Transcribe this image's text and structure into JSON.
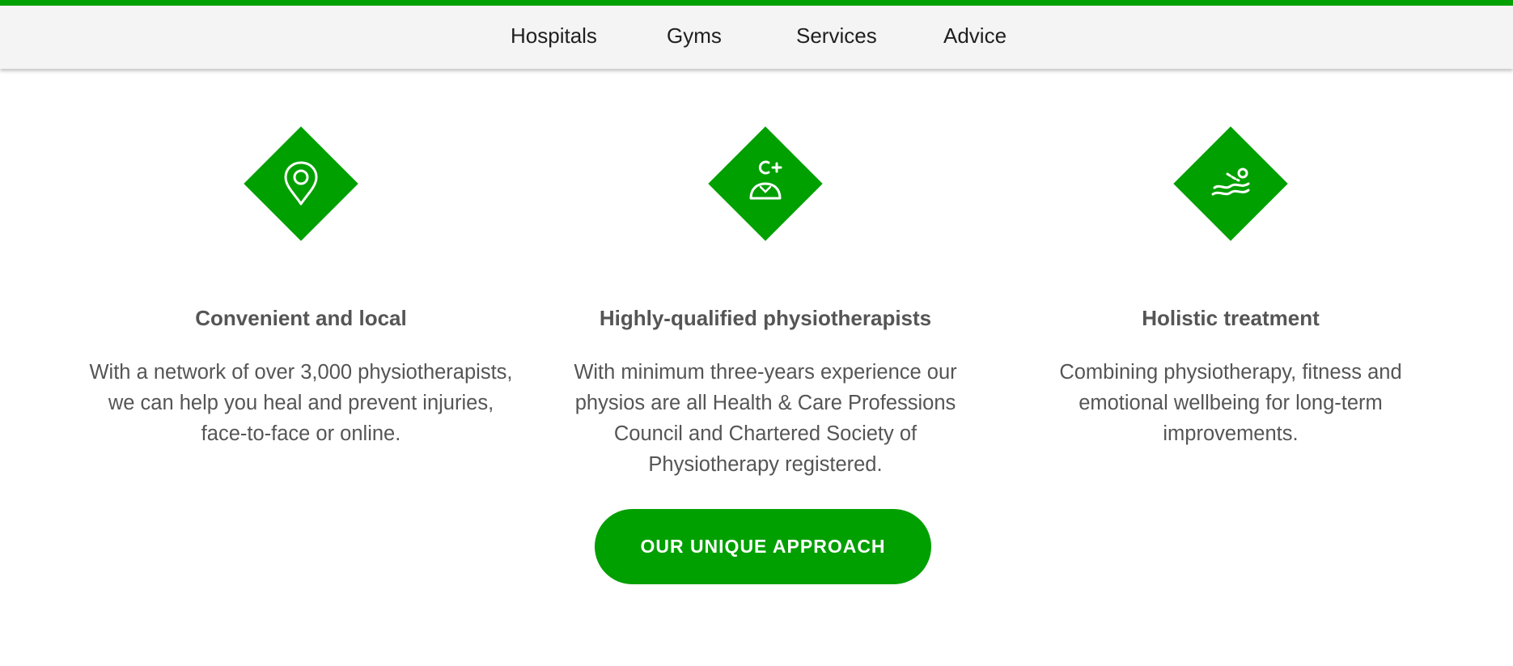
{
  "nav": {
    "items": [
      {
        "label": "Hospitals"
      },
      {
        "label": "Gyms"
      },
      {
        "label": "Services"
      },
      {
        "label": "Advice"
      }
    ]
  },
  "features": [
    {
      "icon": "location-pin-icon",
      "title": "Convenient and local",
      "text": "With a network of over 3,000 physiotherapists, we can help you heal and prevent injuries, face-to-face or online."
    },
    {
      "icon": "qualified-physio-icon",
      "title": "Highly-qualified physiotherapists",
      "text": "With minimum three-years experience our physios are all Health & Care Professions Council and Chartered Society of Physiotherapy registered."
    },
    {
      "icon": "swimmer-icon",
      "title": "Holistic treatment",
      "text": "Combining physiotherapy, fitness and emotional wellbeing for long-term improvements."
    }
  ],
  "cta": {
    "label": "OUR UNIQUE APPROACH"
  },
  "colors": {
    "brand_green": "#00a000",
    "text_gray": "#555555",
    "nav_background": "#f4f4f4"
  }
}
